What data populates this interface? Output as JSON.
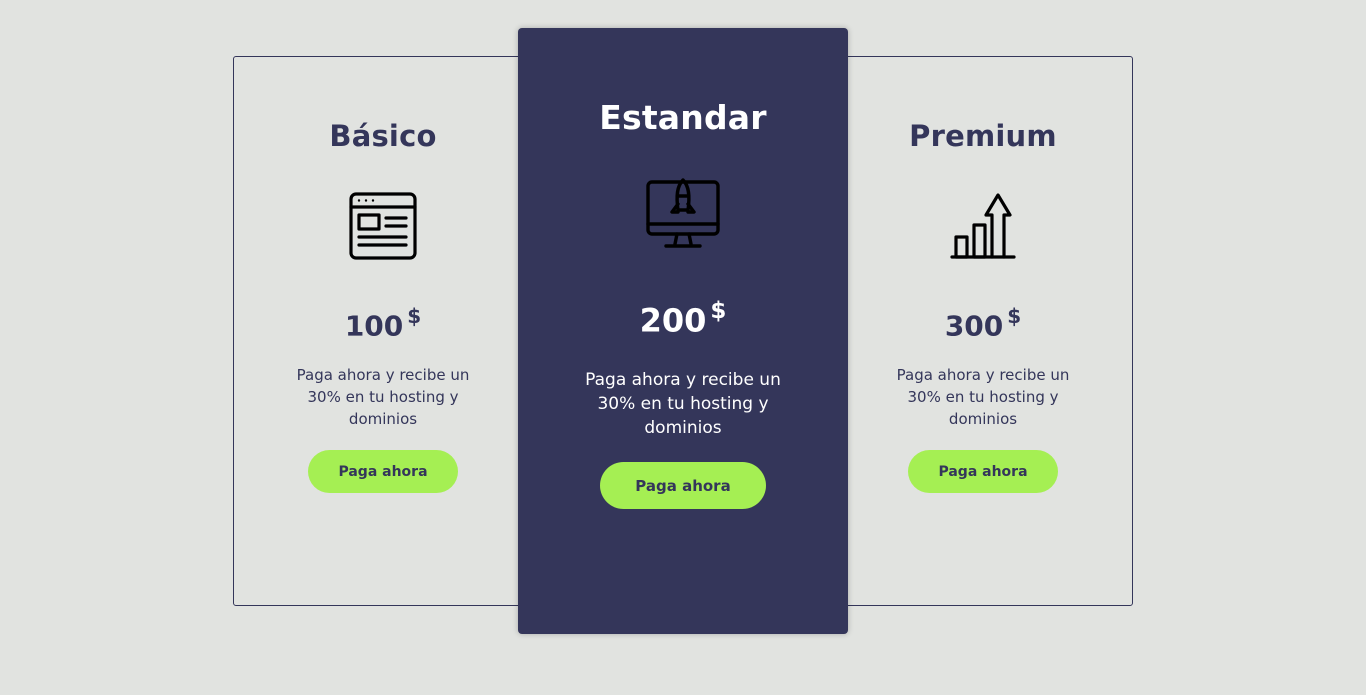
{
  "plans": [
    {
      "title": "Básico",
      "icon": "browser-window-icon",
      "price": "100",
      "currency": "$",
      "description": "Paga ahora y recibe un 30% en tu hosting y dominios",
      "button_label": "Paga ahora"
    },
    {
      "title": "Estandar",
      "icon": "rocket-monitor-icon",
      "price": "200",
      "currency": "$",
      "description": "Paga ahora y recibe un 30% en tu hosting y dominios",
      "button_label": "Paga ahora"
    },
    {
      "title": "Premium",
      "icon": "growth-chart-icon",
      "price": "300",
      "currency": "$",
      "description": "Paga ahora y recibe un 30% en tu hosting y dominios",
      "button_label": "Paga ahora"
    }
  ],
  "colors": {
    "background": "#e1e3e0",
    "primary": "#34365a",
    "accent": "#a5ef53",
    "text_light": "#ffffff"
  }
}
